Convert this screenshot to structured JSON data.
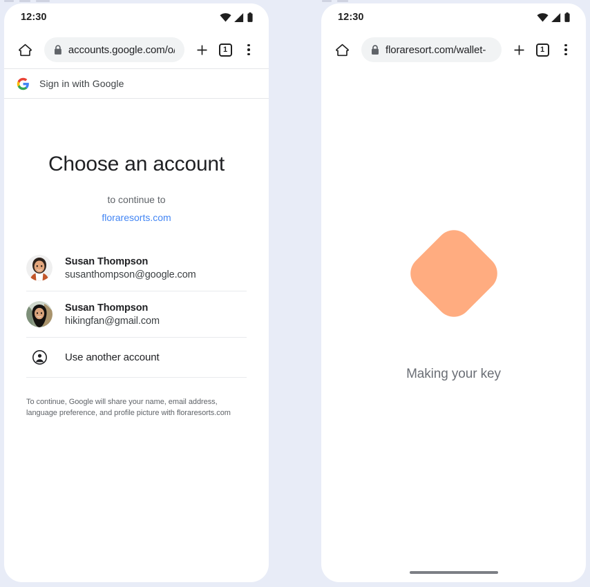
{
  "background_color": "#e8ecf7",
  "phones": {
    "left": {
      "status_bar": {
        "time": "12:30",
        "icons": [
          "wifi-icon",
          "cellular-signal-icon",
          "battery-icon"
        ]
      },
      "browser": {
        "home_icon": "home-icon",
        "lock_icon": "lock-icon",
        "url": "accounts.google.com/o/",
        "new_tab_icon": "plus-icon",
        "tab_count": "1",
        "menu_icon": "kebab-menu-icon"
      },
      "google_header": {
        "logo": "google-g-logo",
        "label": "Sign in with Google"
      },
      "signin": {
        "title": "Choose an account",
        "continue_to": "to continue to",
        "domain": "floraresorts.com",
        "accounts": [
          {
            "name": "Susan Thompson",
            "email": "susanthompson@google.com",
            "avatar": "photo-woman-orange-top"
          },
          {
            "name": "Susan Thompson",
            "email": "hikingfan@gmail.com",
            "avatar": "photo-woman-outdoors"
          }
        ],
        "use_another_account": {
          "icon": "account-circle-icon",
          "label": "Use another account"
        },
        "disclaimer": "To continue, Google will share your name, email address, language preference, and profile picture with floraresorts.com"
      }
    },
    "right": {
      "status_bar": {
        "time": "12:30",
        "icons": [
          "wifi-icon",
          "cellular-signal-icon",
          "battery-icon"
        ]
      },
      "browser": {
        "home_icon": "home-icon",
        "lock_icon": "lock-icon",
        "url": "floraresort.com/wallet-",
        "new_tab_icon": "plus-icon",
        "tab_count": "1",
        "menu_icon": "kebab-menu-icon"
      },
      "making_key": {
        "shape": "rounded-diamond",
        "shape_color": "#ffac80",
        "caption": "Making your key"
      },
      "gesture_bar": "home-indicator"
    }
  },
  "colors": {
    "link_blue": "#4285f4",
    "accent_orange": "#ffac80",
    "text_primary": "#202124",
    "text_secondary": "#5f6368"
  }
}
